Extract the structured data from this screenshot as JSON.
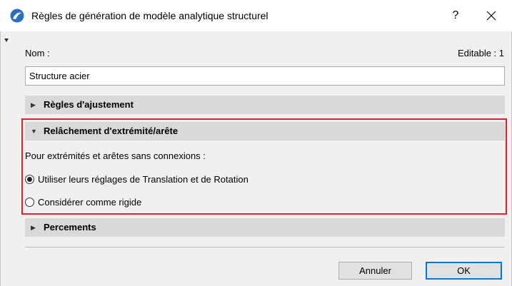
{
  "window": {
    "title": "Règles de génération de modèle analytique structurel",
    "help_label": "?"
  },
  "form": {
    "name_label": "Nom :",
    "editable_label": "Editable : 1",
    "name_value": "Structure acier"
  },
  "sections": {
    "adjustment": {
      "label": "Règles d'ajustement",
      "expanded": false
    },
    "release": {
      "label": "Relâchement d'extrémité/arête",
      "expanded": true,
      "description": "Pour extrémités et arêtes sans connexions :",
      "options": [
        {
          "label": "Utiliser leurs réglages de Translation et de Rotation",
          "selected": true
        },
        {
          "label": "Considérer comme rigide",
          "selected": false
        }
      ]
    },
    "holes": {
      "label": "Percements",
      "expanded": false
    }
  },
  "buttons": {
    "cancel": "Annuler",
    "ok": "OK"
  },
  "colors": {
    "highlight_border": "#e51e2a",
    "section_header_bg": "#d9d9d9",
    "dialog_bg": "#f0f0f0",
    "app_icon_blue": "#2b6fc4"
  },
  "icons": {
    "app": "archicad-logo-icon",
    "close": "close-icon",
    "collapsed": "triangle-right-icon",
    "expanded": "triangle-down-icon"
  }
}
